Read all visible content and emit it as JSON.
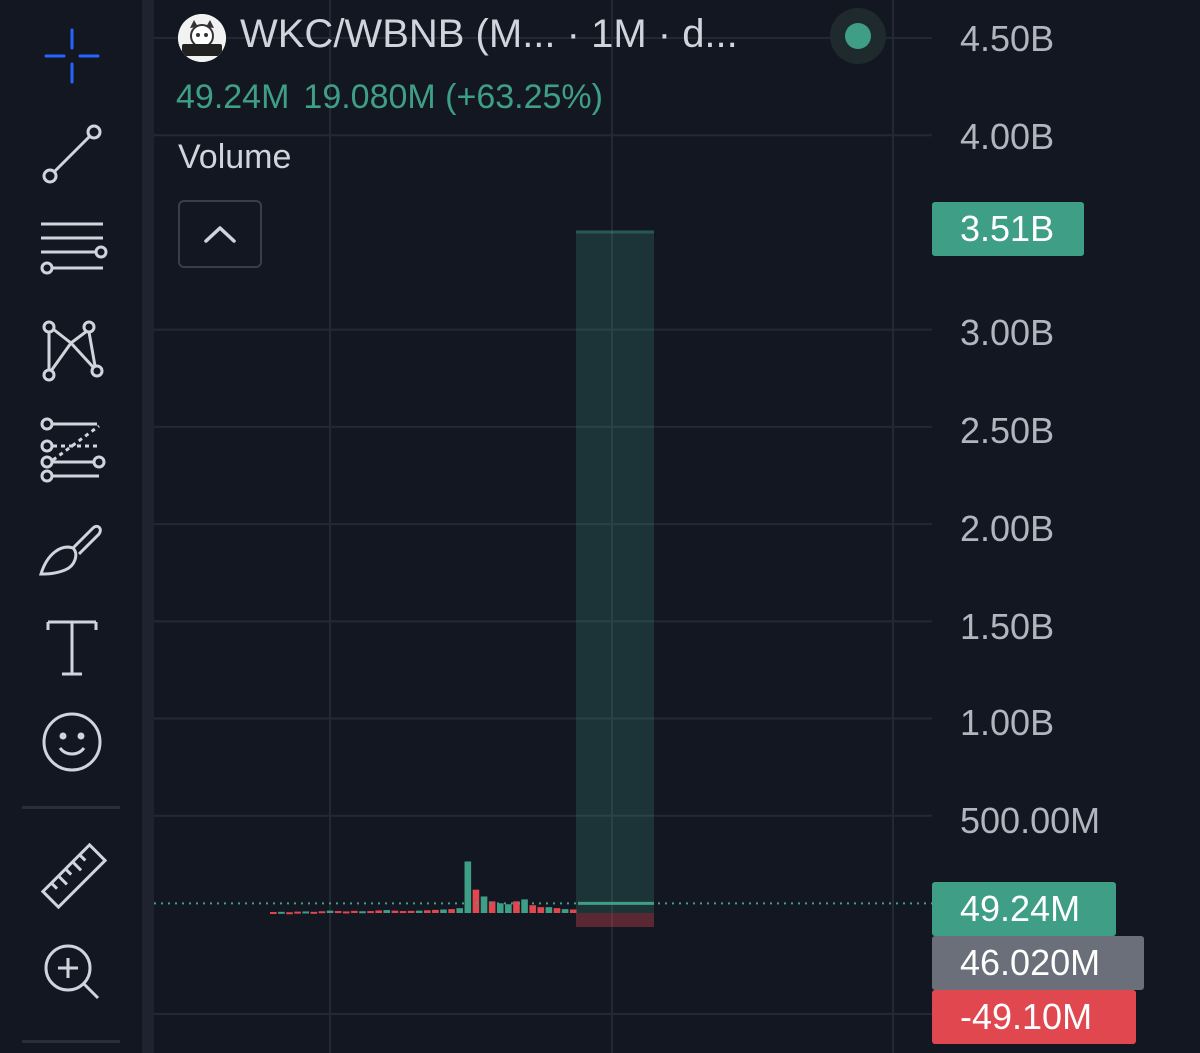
{
  "header": {
    "title": "WKC/WBNB (M... · 1M · d...",
    "logo_text": "Wiki Cat",
    "value": "49.24M",
    "change": "19.080M (+63.25%)",
    "status_color": "#3f9e86"
  },
  "indicator": {
    "label": "Volume"
  },
  "toolbar": {
    "tools": [
      "crosshair-icon",
      "trend-line-icon",
      "horizontal-lines-icon",
      "pattern-icon",
      "fib-icon",
      "brush-icon",
      "text-icon",
      "emoji-icon",
      "ruler-icon",
      "zoom-in-icon"
    ]
  },
  "axis": {
    "labels": [
      "4.50B",
      "4.00B",
      "3.00B",
      "2.50B",
      "2.00B",
      "1.50B",
      "1.00B",
      "500.00M"
    ]
  },
  "tags": {
    "peak": "3.51B",
    "current": "49.24M",
    "previous": "46.020M",
    "negative": "-49.10M"
  },
  "colors": {
    "up": "#3f9e86",
    "down": "#e0474f",
    "grey": "#6b6f7a",
    "background": "#131722"
  },
  "chart_data": {
    "type": "bar",
    "title": "Volume",
    "ylim": [
      -0.05,
      4.55
    ],
    "yunit": "B",
    "tick_values": [
      0.5,
      1.0,
      1.5,
      2.0,
      2.5,
      3.0,
      4.0,
      4.5
    ],
    "grid": true,
    "series": [
      {
        "values": [
          0.005,
          0.006,
          0.004,
          0.007,
          0.008,
          0.006,
          0.009,
          0.012,
          0.01,
          0.008,
          0.011,
          0.009,
          0.01,
          0.013,
          0.015,
          0.012,
          0.01,
          0.011,
          0.012,
          0.014,
          0.016,
          0.018,
          0.02,
          0.025,
          0.265,
          0.12,
          0.085,
          0.06,
          0.05,
          0.045,
          0.06,
          0.07,
          0.04,
          0.03,
          0.03,
          0.025,
          0.02,
          0.018,
          3.51
        ],
        "directions": [
          "down",
          "up",
          "down",
          "down",
          "up",
          "down",
          "down",
          "up",
          "down",
          "down",
          "down",
          "up",
          "down",
          "down",
          "up",
          "down",
          "down",
          "down",
          "up",
          "down",
          "down",
          "up",
          "down",
          "up",
          "up",
          "down",
          "up",
          "down",
          "up",
          "up",
          "down",
          "up",
          "down",
          "down",
          "up",
          "down",
          "up",
          "down",
          "up"
        ]
      }
    ],
    "current_value": 0.04924,
    "negative_value": -0.0491
  }
}
